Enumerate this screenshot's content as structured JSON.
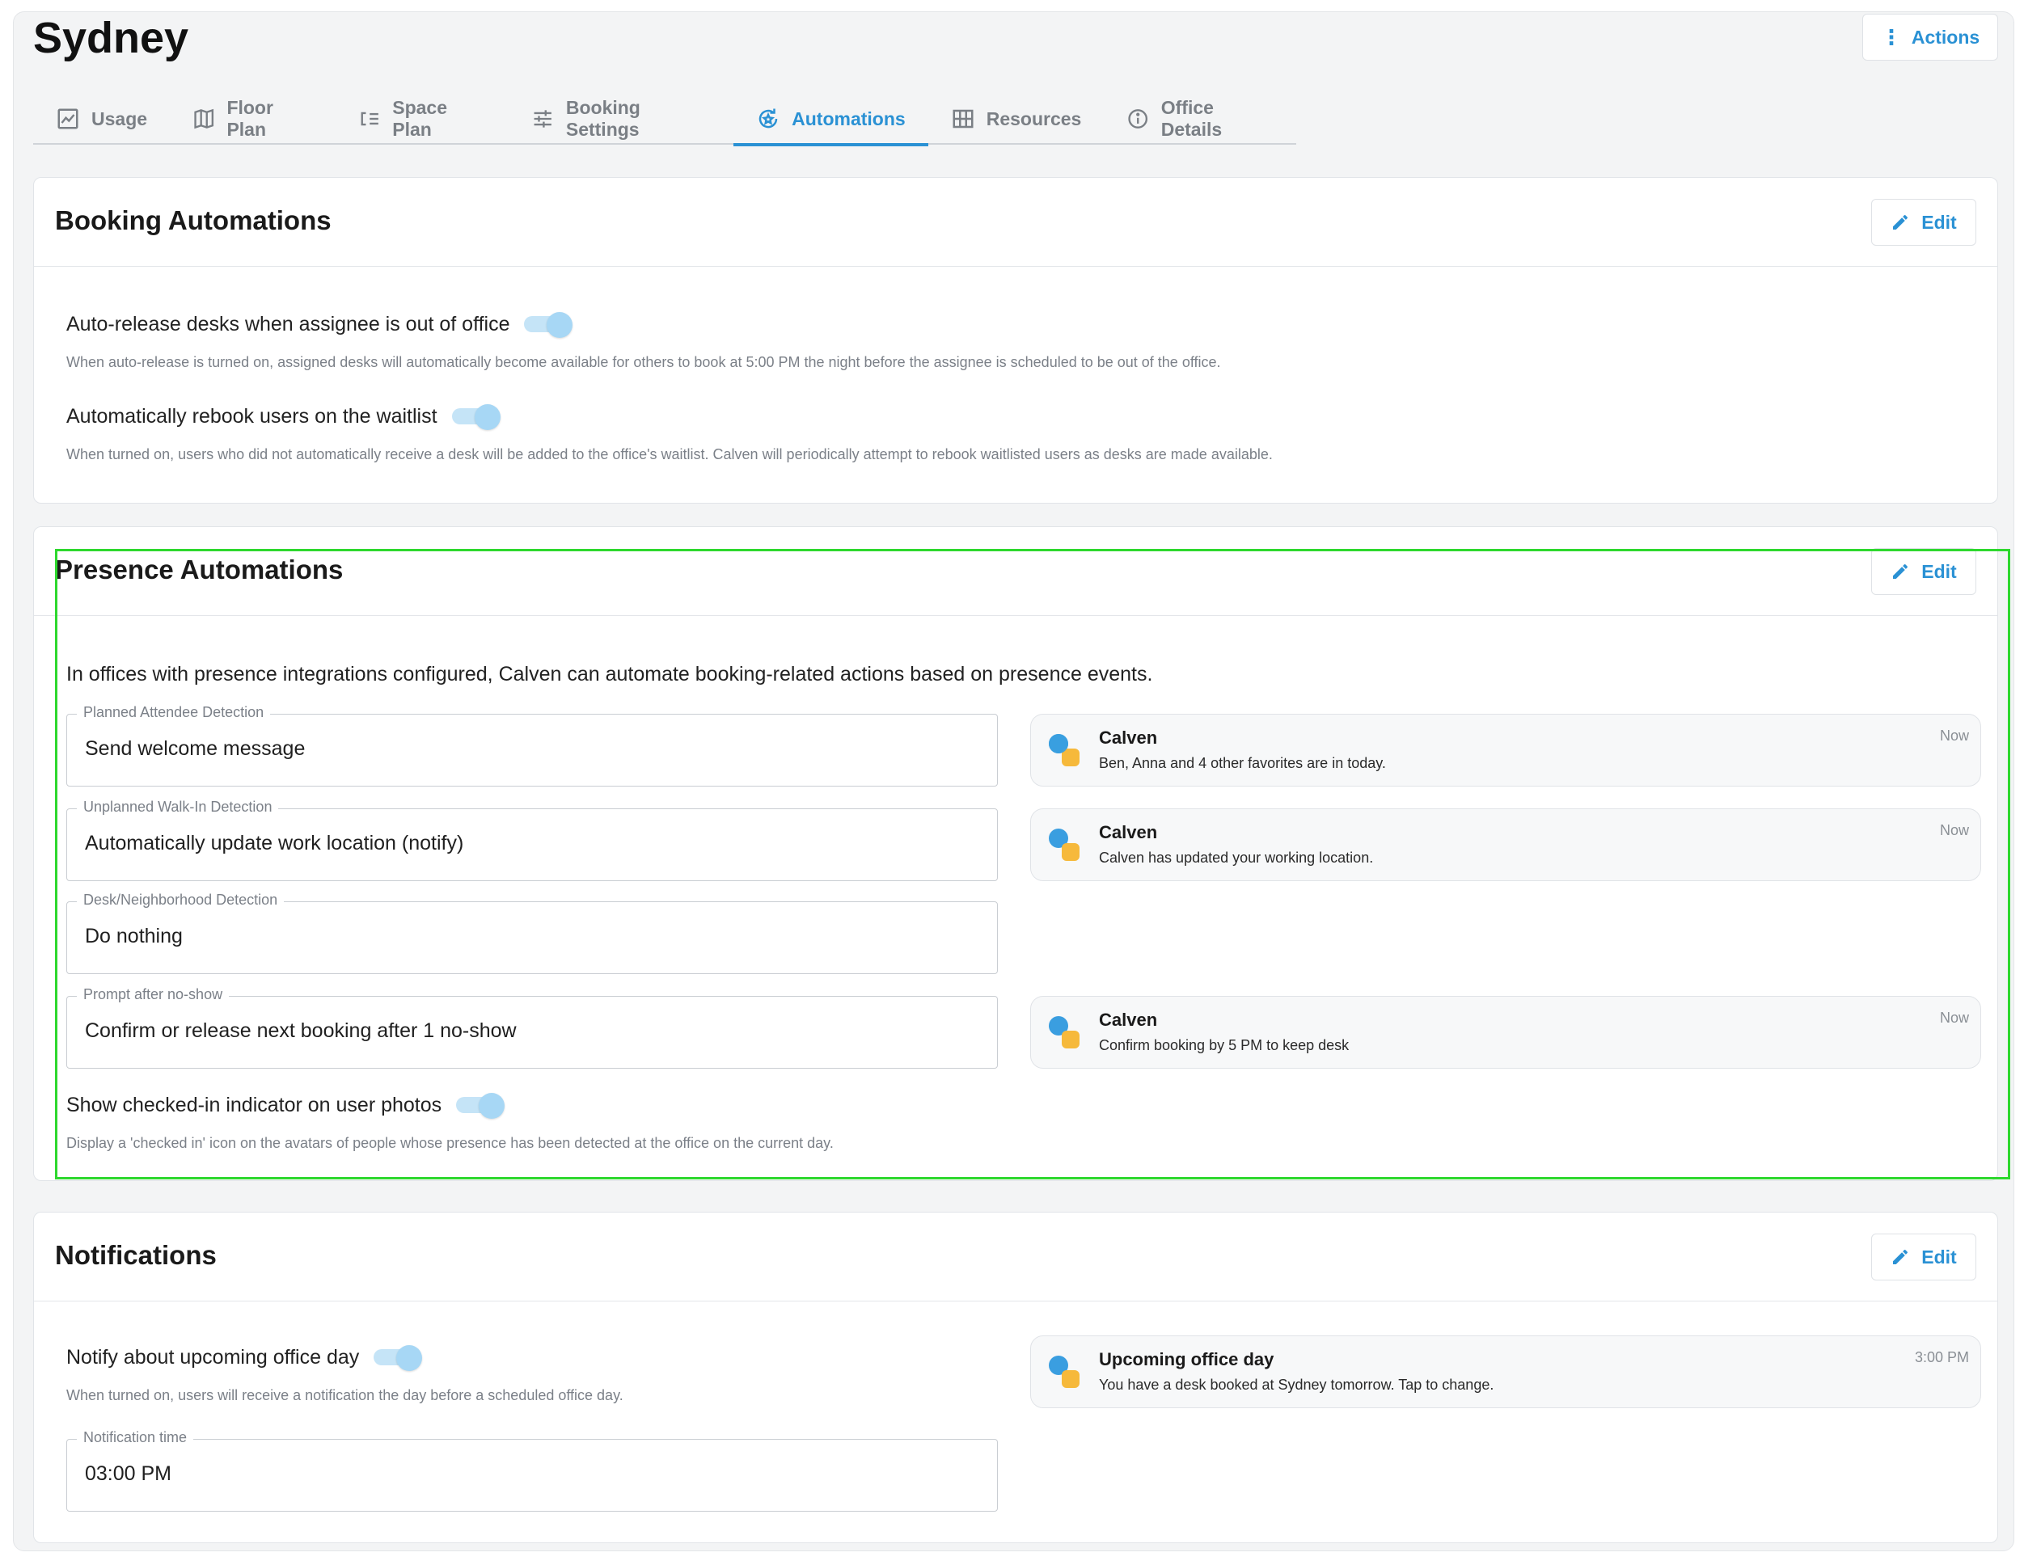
{
  "page": {
    "title": "Sydney",
    "actions_label": "Actions"
  },
  "tabs": [
    {
      "label": "Usage",
      "icon": "chart-icon"
    },
    {
      "label": "Floor Plan",
      "icon": "map-icon"
    },
    {
      "label": "Space Plan",
      "icon": "list-icon"
    },
    {
      "label": "Booking Settings",
      "icon": "sliders-icon"
    },
    {
      "label": "Automations",
      "icon": "automation-icon",
      "active": true
    },
    {
      "label": "Resources",
      "icon": "grid-icon"
    },
    {
      "label": "Office Details",
      "icon": "info-icon"
    }
  ],
  "colors": {
    "accent": "#2a91d4",
    "highlight": "#2ed82e",
    "toggle_on": "#a7d7f5"
  },
  "booking": {
    "title": "Booking Automations",
    "edit_label": "Edit",
    "auto_release": {
      "label": "Auto-release desks when assignee is out of office",
      "hint": "When auto-release is turned on, assigned desks will automatically become available for others to book at 5:00 PM the night before the assignee is scheduled to be out of the office.",
      "enabled": true
    },
    "rebook": {
      "label": "Automatically rebook users on the waitlist",
      "hint": "When turned on, users who did not automatically receive a desk will be added to the office's waitlist. Calven will periodically attempt to rebook waitlisted users as desks are made available.",
      "enabled": true
    }
  },
  "presence": {
    "title": "Presence Automations",
    "edit_label": "Edit",
    "intro": "In offices with presence integrations configured, Calven can automate booking-related actions based on presence events.",
    "fields": [
      {
        "legend": "Planned Attendee Detection",
        "value": "Send welcome message"
      },
      {
        "legend": "Unplanned Walk-In Detection",
        "value": "Automatically update work location (notify)"
      },
      {
        "legend": "Desk/Neighborhood Detection",
        "value": "Do nothing"
      },
      {
        "legend": "Prompt after no-show",
        "value": "Confirm or release next booking after 1 no-show"
      }
    ],
    "notifications": [
      {
        "title": "Calven",
        "body": "Ben, Anna and 4 other favorites are in today.",
        "time": "Now"
      },
      {
        "title": "Calven",
        "body": "Calven has updated your working location.",
        "time": "Now"
      },
      {
        "title": "Calven",
        "body": "Confirm booking by 5 PM to keep desk",
        "time": "Now"
      }
    ],
    "checked_in": {
      "label": "Show checked-in indicator on user photos",
      "hint": "Display a 'checked in' icon on the avatars of people whose presence has been detected at the office on the current day.",
      "enabled": true
    }
  },
  "notifications": {
    "title": "Notifications",
    "edit_label": "Edit",
    "upcoming": {
      "label": "Notify about upcoming office day",
      "hint": "When turned on, users will receive a notification the day before a scheduled office day.",
      "enabled": true
    },
    "time_field": {
      "legend": "Notification time",
      "value": "03:00 PM"
    },
    "preview": {
      "title": "Upcoming office day",
      "body": "You have a desk booked at Sydney tomorrow. Tap to change.",
      "time": "3:00 PM"
    }
  }
}
